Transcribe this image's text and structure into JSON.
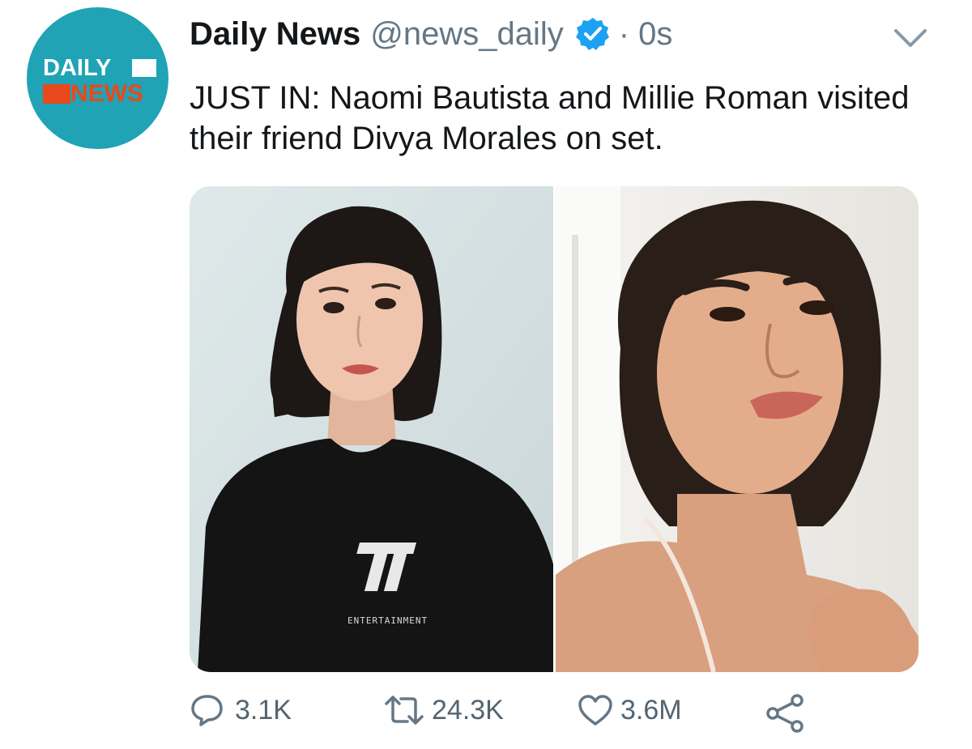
{
  "account": {
    "name": "Daily News",
    "handle": "@news_daily",
    "time": "· 0s",
    "avatar_logo": {
      "line1": "DAILY",
      "line2": "NEWS"
    },
    "verified": true
  },
  "tweet": {
    "text": "JUST IN: Naomi Bautista and Millie Roman visited their friend Divya Morales on set."
  },
  "media": {
    "photos": [
      {
        "name": "photo-left",
        "shirt_logo": "ENTERTAINMENT"
      },
      {
        "name": "photo-right"
      }
    ]
  },
  "actions": {
    "reply_count": "3.1K",
    "retweet_count": "24.3K",
    "like_count": "3.6M"
  },
  "colors": {
    "avatar_bg": "#1fa3b5",
    "logo_accent": "#e8491d",
    "verified": "#1da1f2",
    "muted_text": "#657786"
  },
  "icons": [
    "chevron-down-icon",
    "verified-badge-icon",
    "reply-icon",
    "retweet-icon",
    "like-icon",
    "share-icon"
  ]
}
